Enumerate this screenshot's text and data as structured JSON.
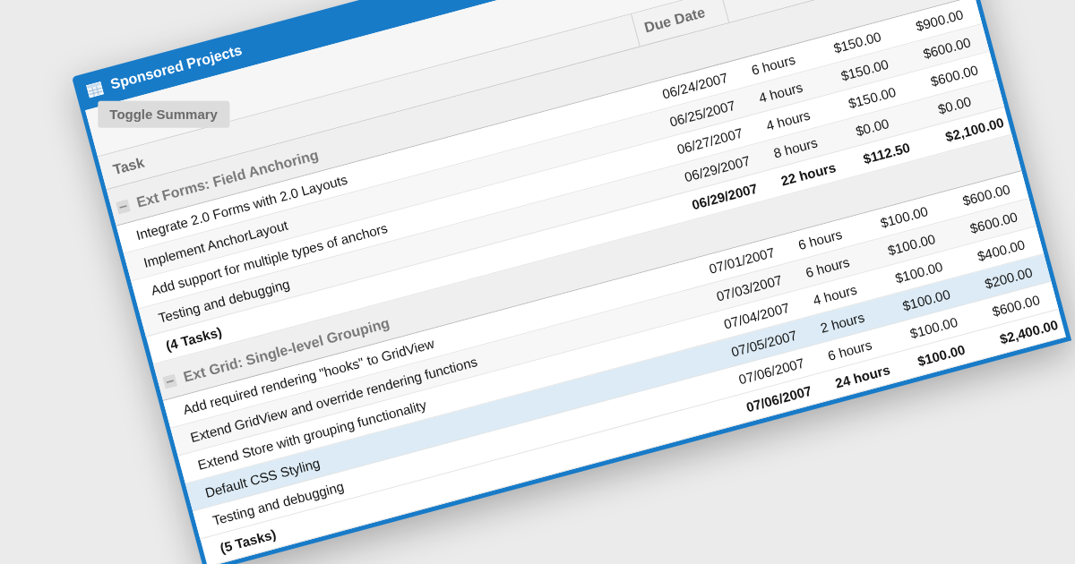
{
  "window": {
    "title": "Sponsored Projects"
  },
  "toolbar": {
    "buttons": [
      {
        "label": "Toggle Summary"
      }
    ]
  },
  "table": {
    "columns": [
      {
        "label": "Task"
      },
      {
        "label": "Due Date"
      }
    ],
    "groups": [
      {
        "title": "Ext Forms: Field Anchoring",
        "expanded": true,
        "rows": [
          {
            "task": "Integrate 2.0 Forms with 2.0 Layouts",
            "due_date": "06/24/2007",
            "column_3": "6 hours",
            "column_4": "$150.00",
            "column_5": "$900.00",
            "selected": false
          },
          {
            "task": "Implement AnchorLayout",
            "due_date": "06/25/2007",
            "column_3": "4 hours",
            "column_4": "$150.00",
            "column_5": "$600.00",
            "selected": false
          },
          {
            "task": "Add support for multiple types of anchors",
            "due_date": "06/27/2007",
            "column_3": "4 hours",
            "column_4": "$150.00",
            "column_5": "$600.00",
            "selected": false
          },
          {
            "task": "Testing and debugging",
            "due_date": "06/29/2007",
            "column_3": "8 hours",
            "column_4": "$0.00",
            "column_5": "$0.00",
            "selected": false
          }
        ],
        "summary": {
          "task": "(4 Tasks)",
          "due_date": "06/29/2007",
          "column_3": "22 hours",
          "column_4": "$112.50",
          "column_5": "$2,100.00"
        }
      },
      {
        "title": "Ext Grid: Single-level Grouping",
        "expanded": true,
        "rows": [
          {
            "task": "Add required rendering \"hooks\" to GridView",
            "due_date": "07/01/2007",
            "column_3": "6 hours",
            "column_4": "$100.00",
            "column_5": "$600.00",
            "selected": false
          },
          {
            "task": "Extend GridView and override rendering functions",
            "due_date": "07/03/2007",
            "column_3": "6 hours",
            "column_4": "$100.00",
            "column_5": "$600.00",
            "selected": false
          },
          {
            "task": "Extend Store with grouping functionality",
            "due_date": "07/04/2007",
            "column_3": "4 hours",
            "column_4": "$100.00",
            "column_5": "$400.00",
            "selected": false
          },
          {
            "task": "Default CSS Styling",
            "due_date": "07/05/2007",
            "column_3": "2 hours",
            "column_4": "$100.00",
            "column_5": "$200.00",
            "selected": true
          },
          {
            "task": "Testing and debugging",
            "due_date": "07/06/2007",
            "column_3": "6 hours",
            "column_4": "$100.00",
            "column_5": "$600.00",
            "selected": false
          }
        ],
        "summary": {
          "task": "(5 Tasks)",
          "due_date": "07/06/2007",
          "column_3": "24 hours",
          "column_4": "$100.00",
          "column_5": "$2,400.00"
        }
      }
    ]
  }
}
